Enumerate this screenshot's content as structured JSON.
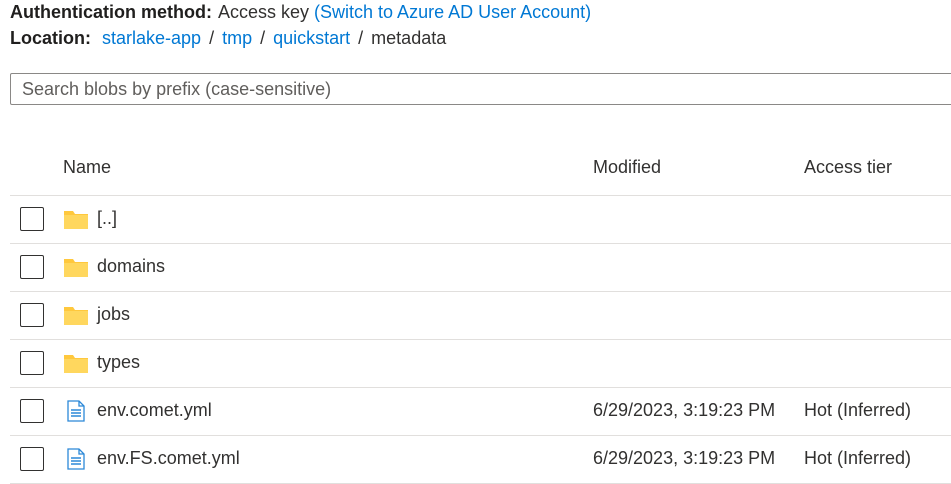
{
  "header": {
    "auth_label": "Authentication method:",
    "auth_value": "Access key",
    "auth_switch_link": "(Switch to Azure AD User Account)",
    "location_label": "Location:",
    "breadcrumb": [
      "starlake-app",
      "tmp",
      "quickstart",
      "metadata"
    ],
    "separator": "/"
  },
  "search": {
    "placeholder": "Search blobs by prefix (case-sensitive)",
    "value": ""
  },
  "table": {
    "columns": {
      "name": "Name",
      "modified": "Modified",
      "access_tier": "Access tier"
    },
    "rows": [
      {
        "type": "folder",
        "icon": "folder-icon",
        "name": "[..]",
        "modified": "",
        "access_tier": ""
      },
      {
        "type": "folder",
        "icon": "folder-icon",
        "name": "domains",
        "modified": "",
        "access_tier": ""
      },
      {
        "type": "folder",
        "icon": "folder-icon",
        "name": "jobs",
        "modified": "",
        "access_tier": ""
      },
      {
        "type": "folder",
        "icon": "folder-icon",
        "name": "types",
        "modified": "",
        "access_tier": ""
      },
      {
        "type": "file",
        "icon": "file-icon",
        "name": "env.comet.yml",
        "modified": "6/29/2023, 3:19:23 PM",
        "access_tier": "Hot (Inferred)"
      },
      {
        "type": "file",
        "icon": "file-icon",
        "name": "env.FS.comet.yml",
        "modified": "6/29/2023, 3:19:23 PM",
        "access_tier": "Hot (Inferred)"
      }
    ]
  },
  "colors": {
    "link": "#0078d4",
    "folder": "#ffc83d",
    "file_icon": "#2b88d8",
    "border": "#e1dfdd",
    "text": "#323130"
  }
}
